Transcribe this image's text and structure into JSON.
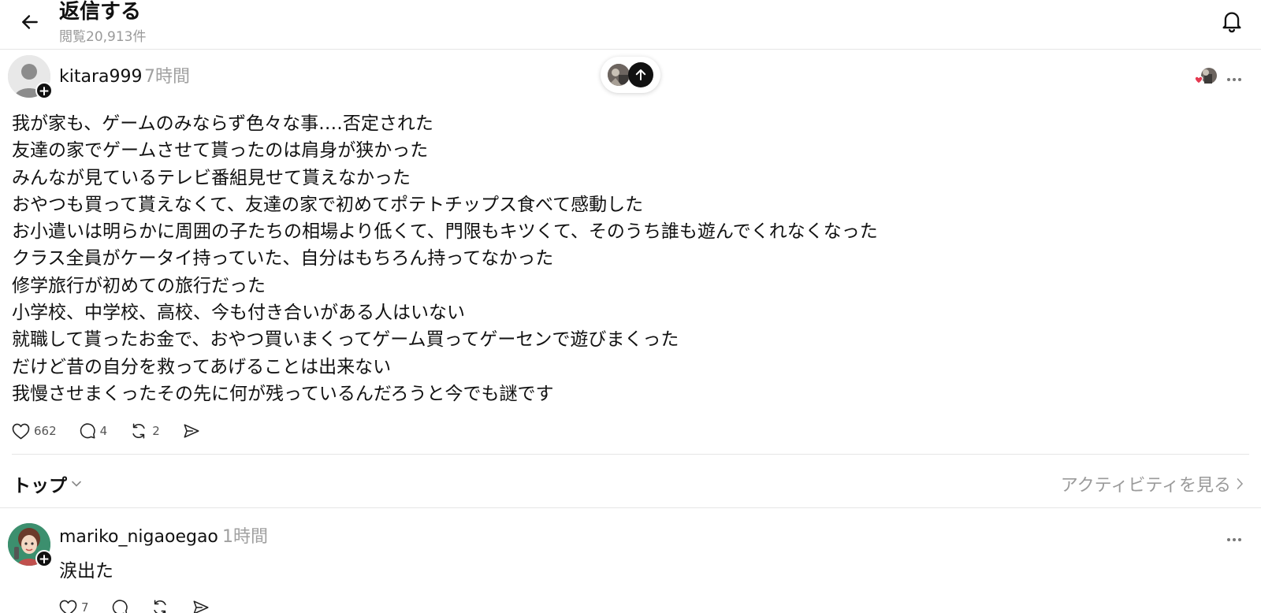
{
  "header": {
    "title": "返信する",
    "views": "閲覧20,913件"
  },
  "post": {
    "username": "kitara999",
    "time": "7時間",
    "lines": [
      "我が家も、ゲームのみならず色々な事‥‥否定された",
      "友達の家でゲームさせて貰ったのは肩身が狭かった",
      "みんなが見ているテレビ番組見せて貰えなかった",
      "おやつも買って貰えなくて、友達の家で初めてポテトチップス食べて感動した",
      "お小遣いは明らかに周囲の子たちの相場より低くて、門限もキツくて、そのうち誰も遊んでくれなくなった",
      "クラス全員がケータイ持っていた、自分はもちろん持ってなかった",
      "修学旅行が初めての旅行だった",
      "小学校、中学校、高校、今も付き合いがある人はいない",
      "就職して貰ったお金で、おやつ買いまくってゲーム買ってゲーセンで遊びまくった",
      "だけど昔の自分を救ってあげることは出来ない",
      "我慢させまくったその先に何が残っているんだろうと今でも謎です"
    ],
    "likes": "662",
    "comments": "4",
    "reposts": "2"
  },
  "sort": {
    "label": "トップ",
    "activity_label": "アクティビティを見る"
  },
  "reply": {
    "username": "mariko_nigaoegao",
    "time": "1時間",
    "text": "涙出た",
    "likes": "7"
  },
  "colors": {
    "like_heart": "#e53950",
    "avatar_green": "#3c8f6e"
  },
  "icons": [
    "back-arrow-icon",
    "bell-icon",
    "heart-icon",
    "comment-icon",
    "repost-icon",
    "share-icon",
    "chevron-down-icon",
    "chevron-right-icon",
    "more-icon",
    "arrow-up-icon"
  ]
}
